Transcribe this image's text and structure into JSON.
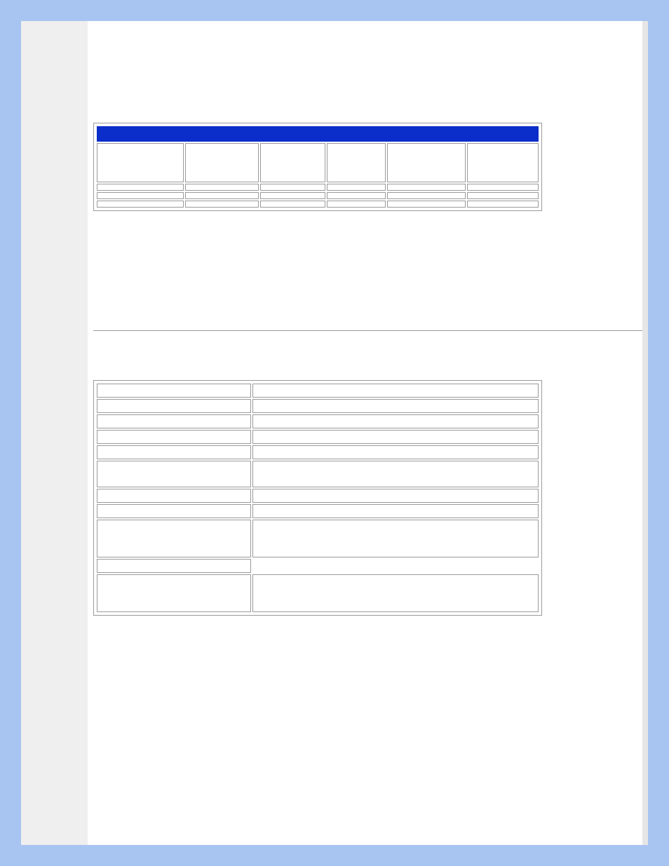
{
  "sidebar": {},
  "table1": {
    "title": "",
    "headers": [
      "",
      "",
      "",
      "",
      "",
      ""
    ],
    "rows": [
      [
        "",
        "",
        "",
        "",
        "",
        ""
      ],
      [
        "",
        "",
        "",
        "",
        "",
        ""
      ],
      [
        "",
        "",
        "",
        "",
        "",
        ""
      ]
    ]
  },
  "table2": {
    "rows": [
      {
        "key": "",
        "val": "",
        "h": "h-1"
      },
      {
        "key": "",
        "val": "",
        "h": "h-1"
      },
      {
        "key": "",
        "val": "",
        "h": "h-1"
      },
      {
        "key": "",
        "val": "",
        "h": "h-1"
      },
      {
        "key": "",
        "val": "",
        "h": "h-1"
      },
      {
        "key": "",
        "val": "",
        "h": "h-2"
      },
      {
        "key": "",
        "val": "",
        "h": "h-1"
      },
      {
        "key": "",
        "val": "",
        "h": "h-1"
      },
      {
        "key": "",
        "val": "",
        "h": "h-3"
      },
      {
        "key": "",
        "val": "",
        "h": "h-1",
        "valBorder": false
      },
      {
        "key": "",
        "val": "",
        "h": "h-3"
      }
    ]
  }
}
